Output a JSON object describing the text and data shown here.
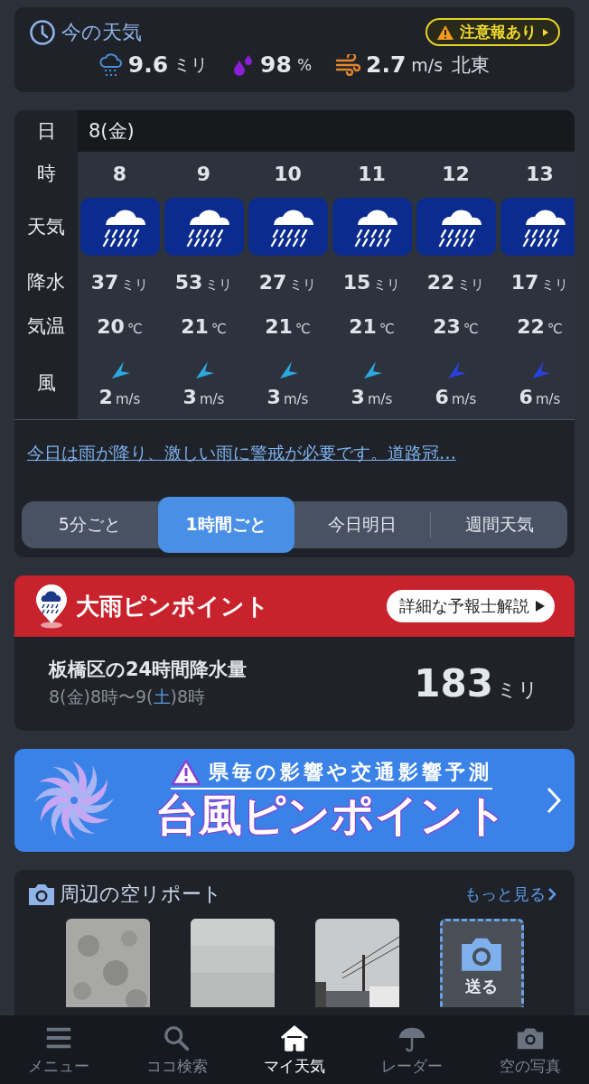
{
  "now": {
    "title": "今の天気",
    "alert": "注意報あり",
    "precip": {
      "value": "9.6",
      "unit": "ミリ"
    },
    "humidity": {
      "value": "98",
      "unit": "%"
    },
    "wind": {
      "value": "2.7",
      "unit": "m/s",
      "direction": "北東"
    }
  },
  "hourly": {
    "labels": [
      "日",
      "時",
      "天気",
      "降水",
      "気温",
      "風"
    ],
    "date": "8(金)",
    "hours": [
      {
        "hour": "8",
        "precip": "37",
        "precip_unit": "ミリ",
        "temp": "20",
        "temp_unit": "℃",
        "color": "#2ba8de",
        "wind": "2",
        "wind_unit": "m/s"
      },
      {
        "hour": "9",
        "precip": "53",
        "precip_unit": "ミリ",
        "temp": "21",
        "temp_unit": "℃",
        "color": "#2ba8de",
        "wind": "3",
        "wind_unit": "m/s"
      },
      {
        "hour": "10",
        "precip": "27",
        "precip_unit": "ミリ",
        "temp": "21",
        "temp_unit": "℃",
        "color": "#2ba8de",
        "wind": "3",
        "wind_unit": "m/s"
      },
      {
        "hour": "11",
        "precip": "15",
        "precip_unit": "ミリ",
        "temp": "21",
        "temp_unit": "℃",
        "color": "#2ba8de",
        "wind": "3",
        "wind_unit": "m/s"
      },
      {
        "hour": "12",
        "precip": "22",
        "precip_unit": "ミリ",
        "temp": "23",
        "temp_unit": "℃",
        "color": "#2a3fe0",
        "wind": "6",
        "wind_unit": "m/s"
      },
      {
        "hour": "13",
        "precip": "17",
        "precip_unit": "ミリ",
        "temp": "22",
        "temp_unit": "℃",
        "color": "#2a3fe0",
        "wind": "6",
        "wind_unit": "m/s"
      }
    ],
    "summary": "今日は雨が降り、激しい雨に警戒が必要です。道路冠…",
    "tabs": [
      {
        "label": "5分ごと",
        "selected": false
      },
      {
        "label": "1時間ごと",
        "selected": true
      },
      {
        "label": "今日明日",
        "selected": false
      },
      {
        "label": "週間天気",
        "selected": false
      }
    ]
  },
  "pinpoint": {
    "title": "大雨ピンポイント",
    "button": "詳細な予報士解説",
    "heading": "板橋区の24時間降水量",
    "period": [
      {
        "text": "8(金)8時〜9(",
        "kind": "plain"
      },
      {
        "text": "土",
        "kind": "saturday"
      },
      {
        "text": ")8時",
        "kind": "plain"
      }
    ],
    "amount": "183",
    "unit": "ミリ"
  },
  "banner": {
    "subtitle": "県毎の影響や交通影響予測",
    "title": "台風ピンポイント"
  },
  "reports": {
    "title": "周辺の空リポート",
    "more": "もっと見る",
    "send": "送る"
  },
  "nav": [
    {
      "label": "メニュー",
      "selected": false
    },
    {
      "label": "ココ検索",
      "selected": false
    },
    {
      "label": "マイ天気",
      "selected": true
    },
    {
      "label": "レーダー",
      "selected": false
    },
    {
      "label": "空の写真",
      "selected": false
    }
  ]
}
